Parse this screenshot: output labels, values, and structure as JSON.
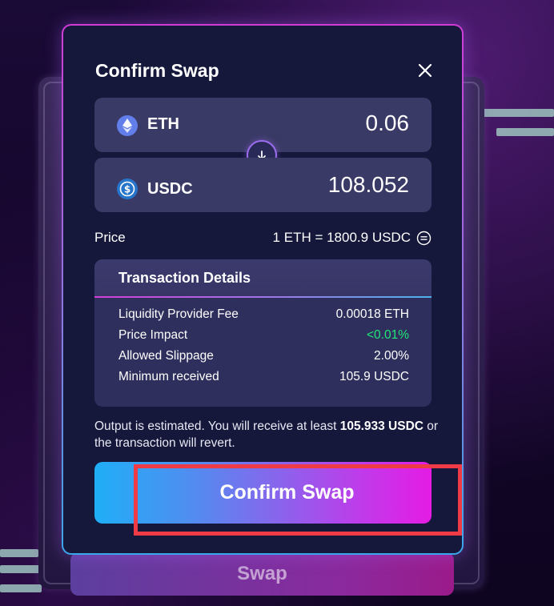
{
  "modal": {
    "title": "Confirm Swap",
    "close_icon": "close-icon"
  },
  "from_token": {
    "symbol": "ETH",
    "amount": "0.06",
    "icon": "ethereum-icon"
  },
  "to_token": {
    "symbol": "USDC",
    "amount": "108.052",
    "icon": "usdc-icon"
  },
  "swap_direction_icon": "arrow-down-icon",
  "price": {
    "label": "Price",
    "value": "1 ETH = 1800.9 USDC",
    "icon": "equals-circle-icon"
  },
  "details": {
    "title": "Transaction Details",
    "rows": [
      {
        "label": "Liquidity Provider Fee",
        "value": "0.00018 ETH"
      },
      {
        "label": "Price Impact",
        "value": "<0.01%"
      },
      {
        "label": "Allowed Slippage",
        "value": "2.00%"
      },
      {
        "label": "Minimum received",
        "value": "105.9 USDC"
      }
    ],
    "price_impact_color": "#22e67a"
  },
  "note": {
    "prefix": "Output is estimated. You will receive at least ",
    "amount": "105.933 USDC",
    "suffix": " or the transaction will revert."
  },
  "confirm_button": {
    "label": "Confirm Swap"
  },
  "background_swap_button": {
    "label": "Swap"
  },
  "colors": {
    "accent_pink": "#e51ce4",
    "accent_blue": "#1faef7",
    "highlight_red": "#ef3b45"
  }
}
